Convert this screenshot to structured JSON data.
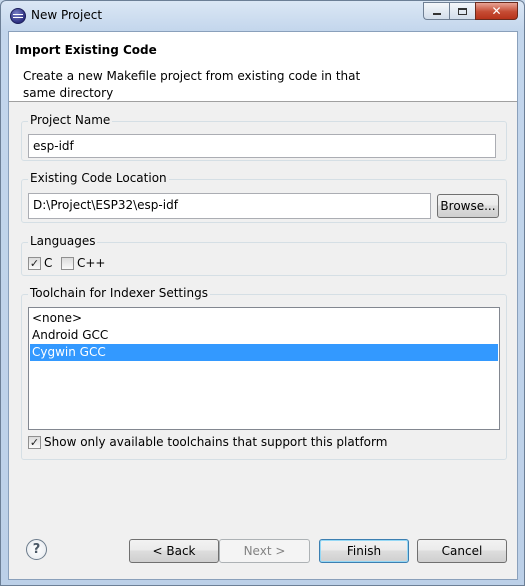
{
  "window": {
    "title": "New Project"
  },
  "banner": {
    "title": "Import Existing Code",
    "description": "Create a new Makefile project from existing code in that same directory"
  },
  "project_name": {
    "label": "Project Name",
    "value": "esp-idf"
  },
  "code_location": {
    "label": "Existing Code Location",
    "value": "D:\\Project\\ESP32\\esp-idf",
    "browse_label": "Browse..."
  },
  "languages": {
    "label": "Languages",
    "items": [
      {
        "label": "C",
        "checked": true,
        "mark": "✓"
      },
      {
        "label": "C++",
        "checked": false,
        "mark": ""
      }
    ]
  },
  "toolchain": {
    "label": "Toolchain for Indexer Settings",
    "options": [
      "<none>",
      "Android GCC",
      "Cygwin GCC"
    ],
    "selected": "Cygwin GCC",
    "filter_label": "Show only available toolchains that support this platform",
    "filter_checked": true,
    "filter_mark": "✓"
  },
  "footer": {
    "help_glyph": "?",
    "back_label": "< Back",
    "next_label": "Next >",
    "finish_label": "Finish",
    "cancel_label": "Cancel"
  },
  "icons": {
    "app": "eclipse-icon",
    "help": "help-icon"
  }
}
